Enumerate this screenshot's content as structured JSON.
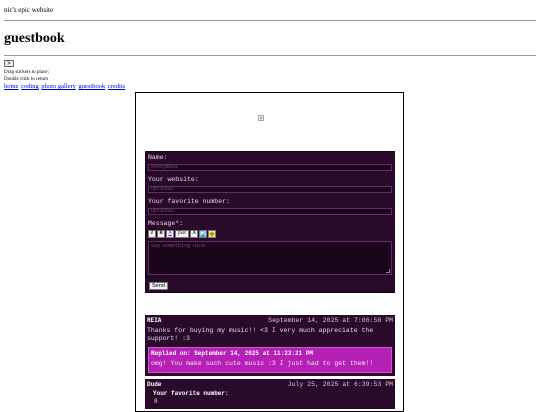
{
  "site": {
    "title": "nic's epic website",
    "heading": "guestbook",
    "toggle_label": ">",
    "hint_line1": "Drag stickers to place;",
    "hint_line2": "Double click to return"
  },
  "nav": {
    "links": [
      "home",
      "coding",
      "photo gallery",
      "guestbook",
      "credits"
    ]
  },
  "form": {
    "name_label": "Name:",
    "name_placeholder": "Anonymous",
    "website_label": "Your website:",
    "website_placeholder": "Optional",
    "number_label": "Your favorite number:",
    "number_placeholder": "Optional",
    "message_label": "Message*:",
    "message_placeholder": "Say something nice",
    "toolbar": [
      "I",
      "B",
      "A",
      "font",
      "A",
      "",
      ""
    ],
    "send_label": "Send"
  },
  "entries": [
    {
      "name": "REIA",
      "date": "September 14, 2025 at 7:06:58 PM",
      "message_line1": "Thanks for buying my music!! <3 I very much appreciate the",
      "message_line2": "support! :3",
      "reply_header": "Replied on: September 14, 2025 at 11:23:21 PM",
      "reply_text": "omg! You make such cute music :3  I just had to get them!!"
    },
    {
      "name": "Dude",
      "date": "July 25, 2025 at 6:39:53 PM",
      "favorite_label": "Your favorite number:",
      "favorite_value": "8"
    }
  ],
  "colors": {
    "panel": "#2a0a2a",
    "reply": "#b521b5",
    "link": "#0000ee"
  }
}
